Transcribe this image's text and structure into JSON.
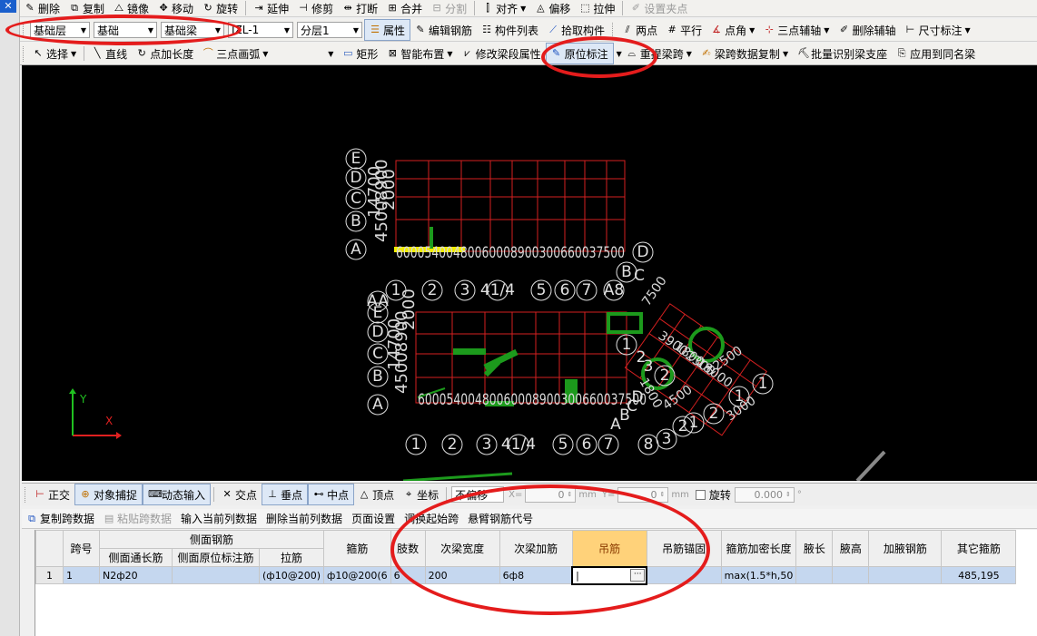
{
  "toolbar1": {
    "items": [
      {
        "label": "删除",
        "icon": "delete-icon",
        "glyph": "✎"
      },
      {
        "label": "复制",
        "icon": "copy-icon",
        "glyph": "⧉"
      },
      {
        "label": "镜像",
        "icon": "mirror-icon",
        "glyph": "⧍"
      },
      {
        "label": "移动",
        "icon": "move-icon",
        "glyph": "✥"
      },
      {
        "label": "旋转",
        "icon": "rotate-icon",
        "glyph": "↻"
      },
      {
        "label": "延伸",
        "icon": "extend-icon",
        "glyph": "⇥"
      },
      {
        "label": "修剪",
        "icon": "trim-icon",
        "glyph": "⊣"
      },
      {
        "label": "打断",
        "icon": "break-icon",
        "glyph": "⇹"
      },
      {
        "label": "合并",
        "icon": "merge-icon",
        "glyph": "⊞"
      },
      {
        "label": "分割",
        "icon": "split-icon",
        "glyph": "⊟",
        "disabled": true
      },
      {
        "label": "对齐",
        "icon": "align-icon",
        "glyph": "⫿",
        "dropdown": true
      },
      {
        "label": "偏移",
        "icon": "offset-icon",
        "glyph": "◬"
      },
      {
        "label": "拉伸",
        "icon": "stretch-icon",
        "glyph": "⬚"
      },
      {
        "label": "设置夹点",
        "icon": "grip-point-icon",
        "glyph": "✐",
        "disabled": true
      }
    ]
  },
  "toolbar2": {
    "combo_floor": "基础层",
    "combo_category": "基础",
    "combo_type": "基础梁",
    "combo_member": "JZL-1",
    "combo_layer": "分层1",
    "btn_properties": "属性",
    "btn_edit_rebar": "编辑钢筋",
    "btn_member_list": "构件列表",
    "btn_pick_member": "拾取构件",
    "btn_two_points": "两点",
    "btn_parallel": "平行",
    "btn_point_angle": "点角",
    "btn_three_point_axis": "三点辅轴",
    "btn_delete_axis": "删除辅轴",
    "btn_dimension": "尺寸标注"
  },
  "toolbar3": {
    "btn_select": "选择",
    "btn_line": "直线",
    "btn_point_length": "点加长度",
    "btn_three_point_arc": "三点画弧",
    "btn_rect": "矩形",
    "btn_smart_layout": "智能布置",
    "btn_modify_span": "修改梁段属性",
    "btn_original_mark": "原位标注",
    "btn_reextract_span": "重提梁跨",
    "btn_copy_span_data": "梁跨数据复制",
    "btn_batch_identify": "批量识别梁支座",
    "btn_apply_same": "应用到同名梁"
  },
  "canvas": {
    "bg": "#000000",
    "grid_color": "#d42020",
    "axis_labels_top_left": [
      "E",
      "D",
      "C",
      "B",
      "A"
    ],
    "axis_labels_top_bottom": [
      "1",
      "2",
      "3",
      "41/4",
      "5",
      "6",
      "7",
      "A8"
    ],
    "dim_top_bottom": "60005400480060008900300660037500",
    "dim_top_vertical": "14700",
    "dim_top_vertical2": "45008900",
    "dim_top_vertical3": "2000",
    "right_labels_top": [
      "D",
      "B",
      "C"
    ],
    "axis_labels_lower_left": [
      "AA",
      "E",
      "D",
      "C",
      "B",
      "A"
    ],
    "axis_labels_lower_bottom": [
      "1",
      "2",
      "3",
      "41/4",
      "5",
      "6",
      "7",
      "8"
    ],
    "dim_lower_bottom": "60005400480060008900300660037500",
    "dim_lower_vertical": "14700",
    "dim_lower_vertical2": "45008900",
    "dim_lower_vertical3": "2000",
    "rotated_labels": [
      "1",
      "2",
      "3",
      "2",
      "1",
      "1",
      "2",
      "3",
      "2",
      "1",
      "A",
      "B",
      "C",
      "D"
    ],
    "rotated_dims": [
      "7500",
      "3900",
      "1800",
      "2300",
      "18000",
      "12500",
      "1800",
      "4500",
      "3000"
    ],
    "axis_x": "X",
    "axis_y": "Y"
  },
  "statusbar": {
    "btn_ortho": "正交",
    "btn_snap": "对象捕捉",
    "btn_dynamic_input": "动态输入",
    "btn_intersection": "交点",
    "btn_perpendicular": "垂点",
    "btn_midpoint": "中点",
    "btn_vertex": "顶点",
    "btn_coord": "坐标",
    "offset_mode": "不偏移",
    "x_label": "X=",
    "x_value": "0",
    "y_label": "Y=",
    "y_value": "0",
    "unit": "mm",
    "rotate_label": "旋转",
    "rotate_value": "0.000",
    "rotate_unit": "°"
  },
  "grid_toolbar": {
    "btn_copy_span": "复制跨数据",
    "btn_paste_span": "粘贴跨数据",
    "btn_input_col": "输入当前列数据",
    "btn_delete_col": "删除当前列数据",
    "btn_page_setup": "页面设置",
    "btn_swap_start": "调换起始跨",
    "btn_cantilever": "悬臂钢筋代号"
  },
  "grid": {
    "group_side": "侧面钢筋",
    "headers": [
      "跨号",
      "侧面通长筋",
      "侧面原位标注筋",
      "拉筋",
      "箍筋",
      "肢数",
      "次梁宽度",
      "次梁加筋",
      "吊筋",
      "吊筋锚固",
      "箍筋加密长度",
      "腋长",
      "腋高",
      "加腋钢筋",
      "其它箍筋"
    ],
    "rows": [
      {
        "index": "1",
        "cells": [
          "1",
          "N2ф20",
          "",
          "(ф10@200)",
          "ф10@200(6",
          "6",
          "200",
          "6ф8",
          "",
          "",
          "max(1.5*h,50",
          "",
          "",
          "",
          "485,195"
        ]
      }
    ]
  },
  "colors": {
    "annotation_red": "#e41c1c",
    "highlight_yellow": "#f2ec00",
    "beam_green": "#1c9a1c",
    "axis_x_color": "#e02020",
    "axis_y_color": "#20c020"
  }
}
